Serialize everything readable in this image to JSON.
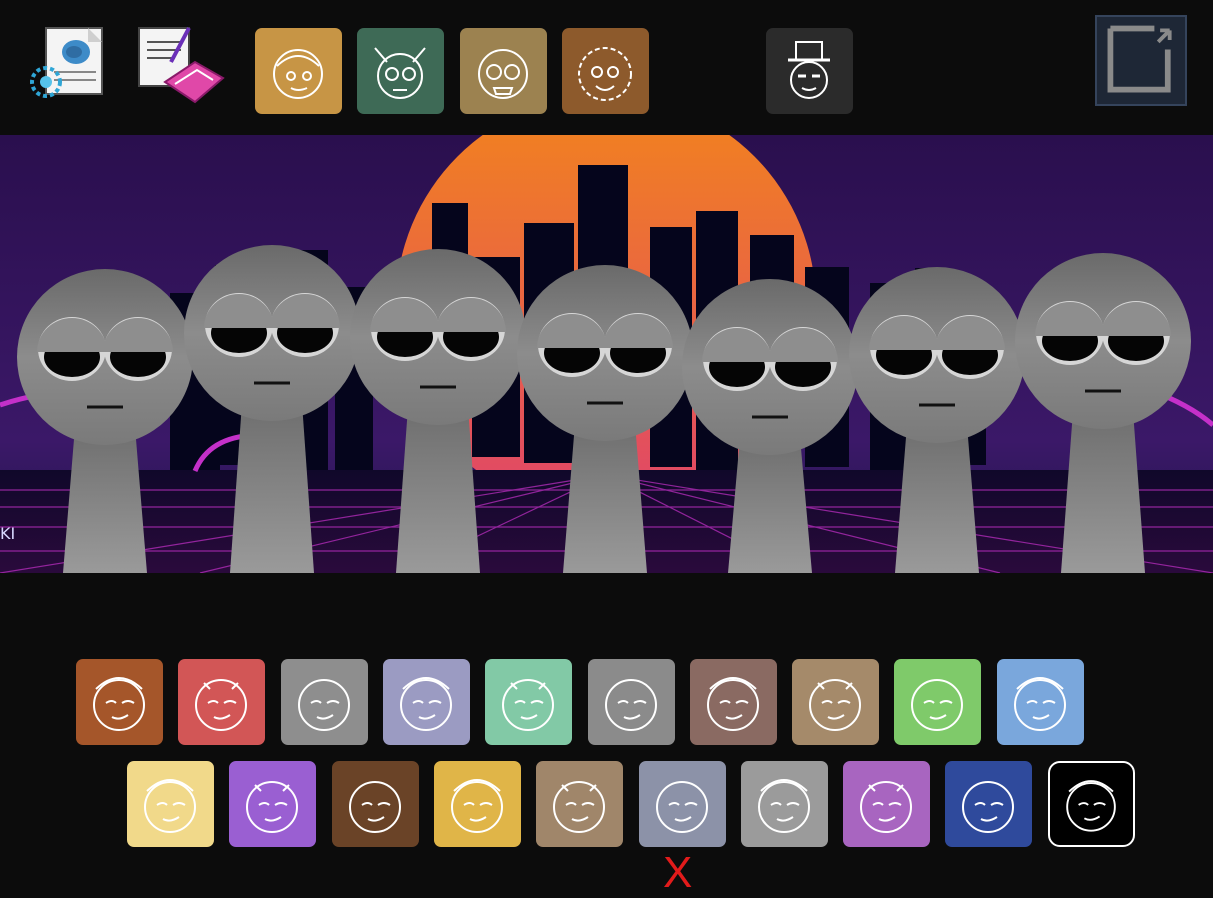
{
  "app": {
    "stage_label": "KI",
    "close_label": "X"
  },
  "colors": {
    "background": "#0c0c0c",
    "sun": "#f2841c",
    "sky": "#2a0f4e",
    "character_grey": "#8a8a8a",
    "neon_pink": "#c430c9",
    "close_red": "#e21b1b"
  },
  "toolbar": {
    "icons": [
      "web-document-icon",
      "write-mail-icon"
    ],
    "bonus_icons": [
      "mystery-character-1",
      "mystery-character-2",
      "mystery-character-3",
      "mystery-character-4"
    ],
    "special_icon": "top-hat-character",
    "fullscreen_icon": "fullscreen-icon"
  },
  "stage": {
    "characters": 7
  },
  "palette": {
    "row1": [
      {
        "name": "headphones-character",
        "color": "#a5562a"
      },
      {
        "name": "spiky-character",
        "color": "#d25656"
      },
      {
        "name": "beret-character",
        "color": "#8e8e8e"
      },
      {
        "name": "robot-character",
        "color": "#9b9bc2"
      },
      {
        "name": "antenna-character",
        "color": "#82c9a6"
      },
      {
        "name": "horned-character",
        "color": "#8b8b8b"
      },
      {
        "name": "monocle-character",
        "color": "#8a6a62"
      },
      {
        "name": "cap-character",
        "color": "#a58a6a"
      },
      {
        "name": "flame-hair-character",
        "color": "#7fca6a"
      },
      {
        "name": "bear-ears-character",
        "color": "#7aa7dc"
      }
    ],
    "row2": [
      {
        "name": "sun-character",
        "color": "#f1d98a"
      },
      {
        "name": "devil-character",
        "color": "#9a5fd2"
      },
      {
        "name": "tree-character",
        "color": "#6a4327"
      },
      {
        "name": "bee-character",
        "color": "#e0b548"
      },
      {
        "name": "cowboy-character",
        "color": "#a0866a"
      },
      {
        "name": "tv-character",
        "color": "#8c92a8"
      },
      {
        "name": "cat-character",
        "color": "#9b9b9b"
      },
      {
        "name": "bunny-character",
        "color": "#a865c0"
      },
      {
        "name": "hair-character",
        "color": "#2f4a9c"
      },
      {
        "name": "top-hat-character",
        "color": "#000000"
      }
    ]
  }
}
